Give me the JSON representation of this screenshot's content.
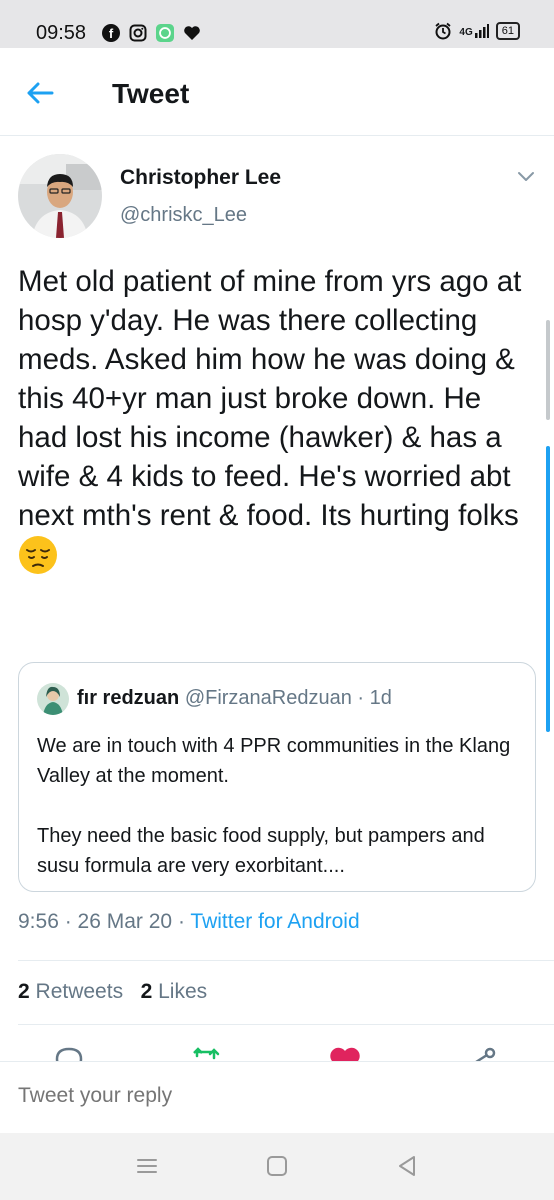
{
  "status_bar": {
    "time": "09:58",
    "left_icons": [
      "facebook-icon",
      "instagram-icon",
      "message-icon",
      "heart-icon"
    ],
    "right_icons": [
      "alarm-icon",
      "signal-4g-icon"
    ],
    "network": "4G",
    "battery": "61"
  },
  "header": {
    "title": "Tweet"
  },
  "tweet": {
    "author_name": "Christopher Lee",
    "author_handle": "@chriskc_Lee",
    "text": "Met old patient of mine from yrs ago at hosp y'day. He was there collecting meds. Asked him how he was doing & this 40+yr man just broke down. He had lost his income (hawker) & has a wife & 4 kids to feed. He's worried abt next mth's rent & food. Its hurting folks",
    "emoji": "pensive-face"
  },
  "quote": {
    "name": "fır redzuan",
    "handle": "@FirzanaRedzuan",
    "separator": " · ",
    "age": "1d",
    "paragraph1": "We are in touch with 4 PPR communities in the Klang Valley at the moment.",
    "paragraph2": "They need the basic food supply, but pampers and susu formula are very exorbitant...."
  },
  "meta": {
    "time": "9:56",
    "sep1": " · ",
    "date": "26 Mar 20",
    "sep2": " · ",
    "source": "Twitter for Android"
  },
  "stats": {
    "retweets_count": "2",
    "retweets_label": "Retweets",
    "likes_count": "2",
    "likes_label": "Likes"
  },
  "reply": {
    "placeholder": "Tweet your reply"
  },
  "colors": {
    "accent": "#1da1f2",
    "like": "#e0245e",
    "retweet": "#17bf63",
    "secondary_text": "#657786"
  }
}
